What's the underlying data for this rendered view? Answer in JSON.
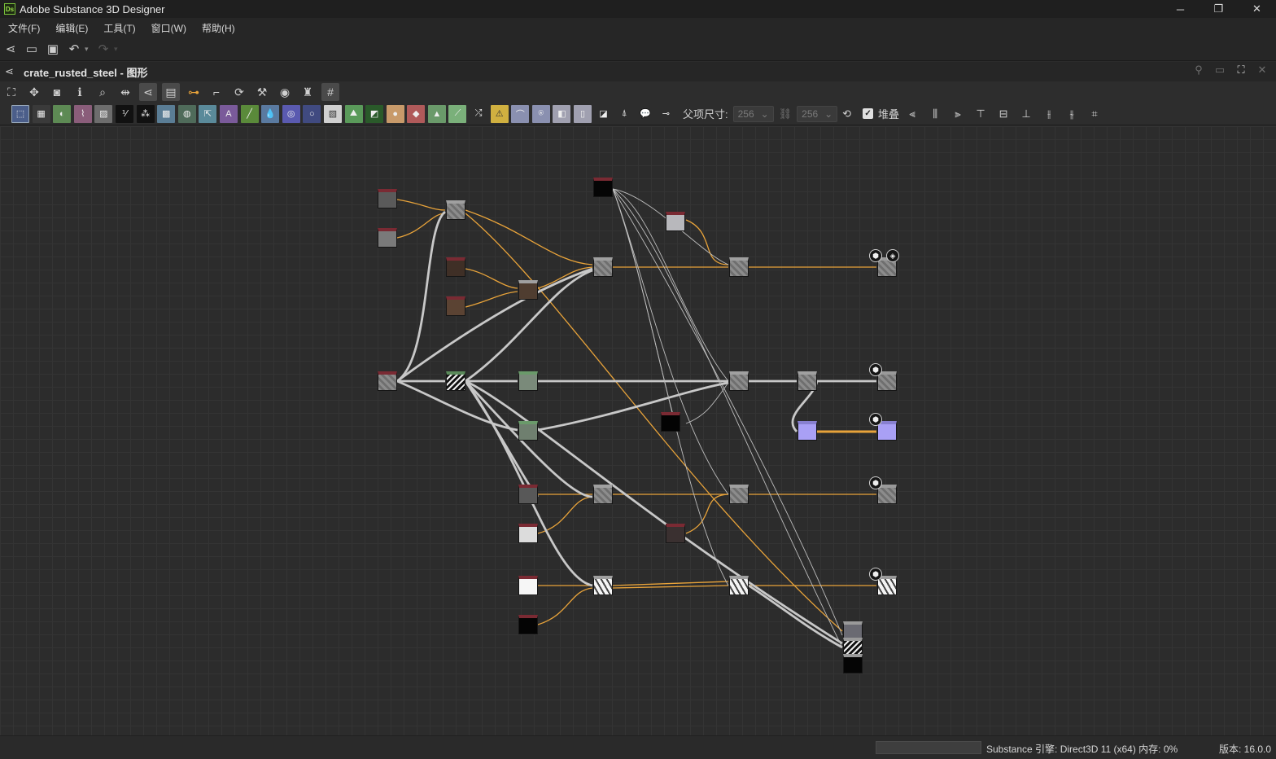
{
  "app": {
    "title": "Adobe Substance 3D Designer",
    "logo_text": "Ds"
  },
  "window_controls": {
    "minimize": "─",
    "restore": "❐",
    "close": "✕"
  },
  "menu": [
    "文件(F)",
    "编辑(E)",
    "工具(T)",
    "窗口(W)",
    "帮助(H)"
  ],
  "graph": {
    "title": "crate_rusted_steel - 图形"
  },
  "graph_toolbar": {
    "parent_size_label": "父项尺寸:",
    "width_value": "256",
    "height_value": "256",
    "stack_label": "堆叠",
    "stack_checked": true
  },
  "status": {
    "engine": "Substance 引擎:  Direct3D 11 (x64)  内存:  0%",
    "version": "版本:  16.0.0"
  },
  "colors": {
    "orange_link": "#e8a33a",
    "gray_link": "#c8c8c8",
    "node_header": "#7a2a33",
    "normal_purple": "#a9a0f5"
  }
}
